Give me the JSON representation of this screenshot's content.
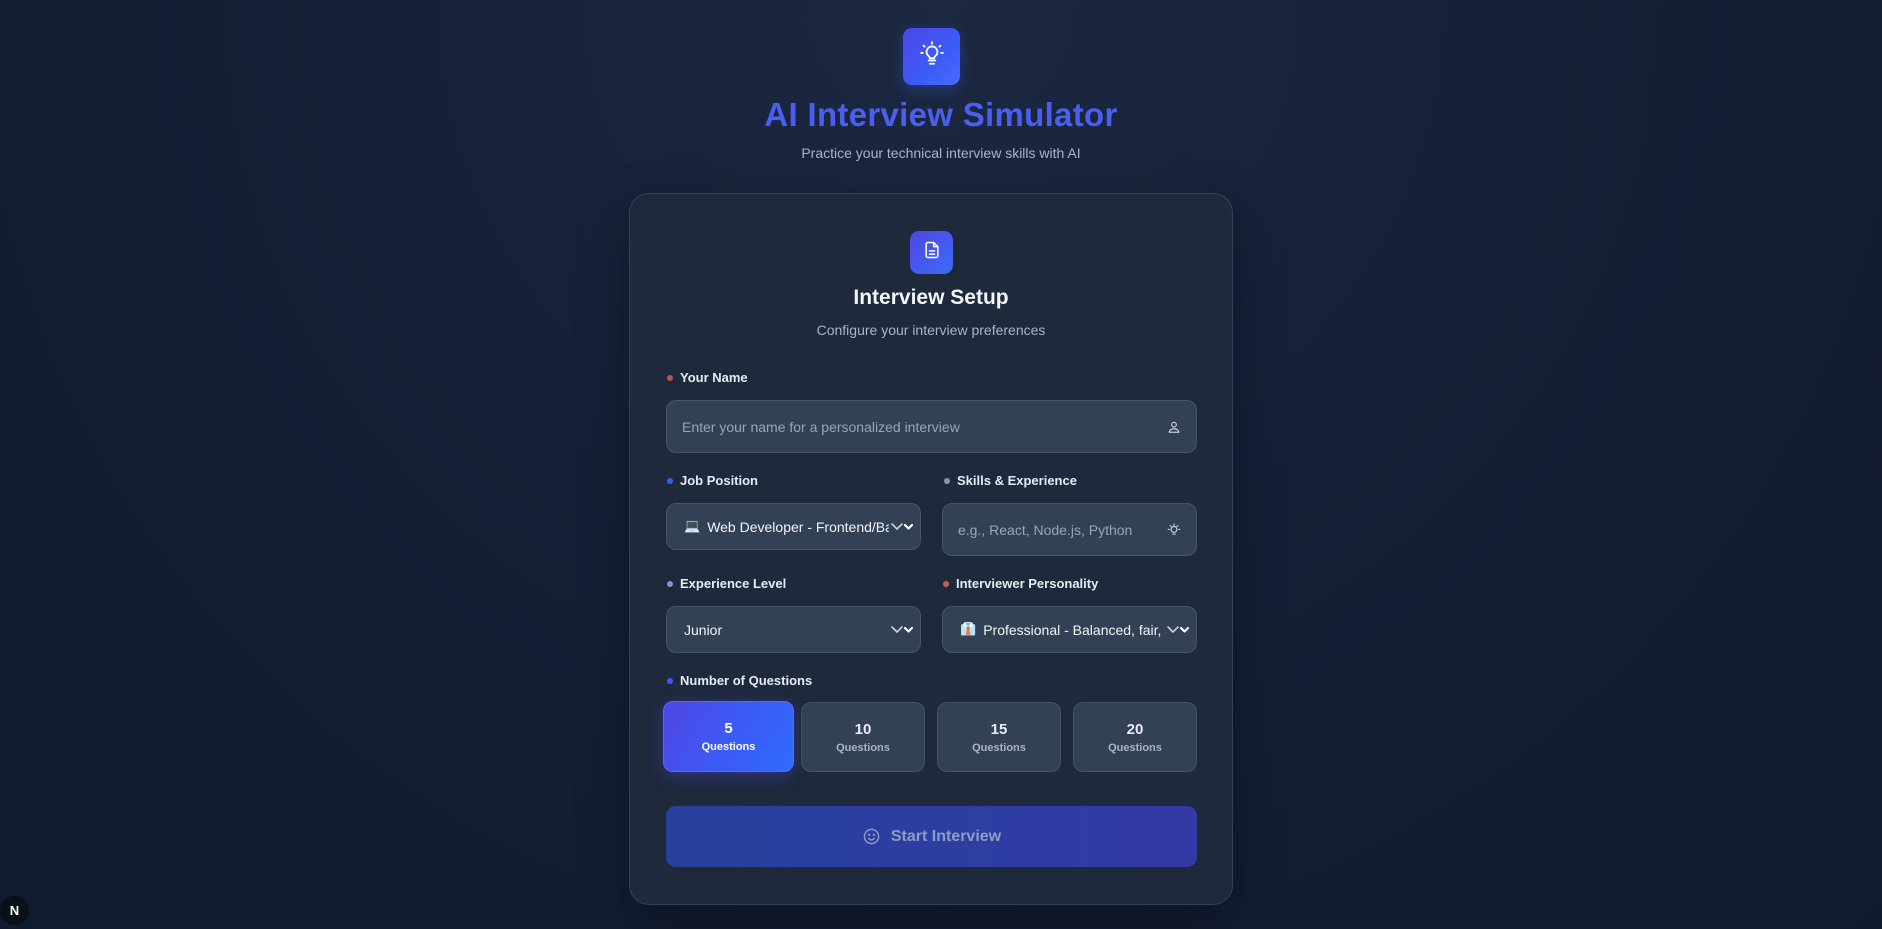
{
  "header": {
    "logo_icon": "lightbulb-icon",
    "title": "AI Interview Simulator",
    "subtitle": "Practice your technical interview skills with AI"
  },
  "setup": {
    "icon": "document-icon",
    "title": "Interview Setup",
    "subtitle": "Configure your interview preferences"
  },
  "fields": {
    "name": {
      "label": "Your Name",
      "value": "",
      "placeholder": "Enter your name for a personalized interview",
      "icon": "user-icon",
      "dot_color": "#c0504d"
    },
    "job_position": {
      "label": "Job Position",
      "selected_emoji": "💻",
      "selected": "Web Developer - Frontend/Backend",
      "dot_color": "#3b5bf6"
    },
    "skills": {
      "label": "Skills & Experience",
      "value": "",
      "placeholder": "e.g., React, Node.js, Python",
      "icon": "lightbulb-icon",
      "dot_color": "#8b93a6"
    },
    "experience": {
      "label": "Experience Level",
      "selected": "Junior",
      "dot_color": "#8b8fd6"
    },
    "personality": {
      "label": "Interviewer Personality",
      "selected_emoji": "👔",
      "selected": "Professional - Balanced, fair, and thorough",
      "dot_color": "#c0644d"
    }
  },
  "questions": {
    "label": "Number of Questions",
    "dot_color": "#3b5bf6",
    "selected": 5,
    "options": [
      {
        "count": "5",
        "word": "Questions"
      },
      {
        "count": "10",
        "word": "Questions"
      },
      {
        "count": "15",
        "word": "Questions"
      },
      {
        "count": "20",
        "word": "Questions"
      }
    ]
  },
  "start_button": {
    "label": "Start Interview",
    "icon": "smile-icon"
  },
  "dev_badge": "N"
}
